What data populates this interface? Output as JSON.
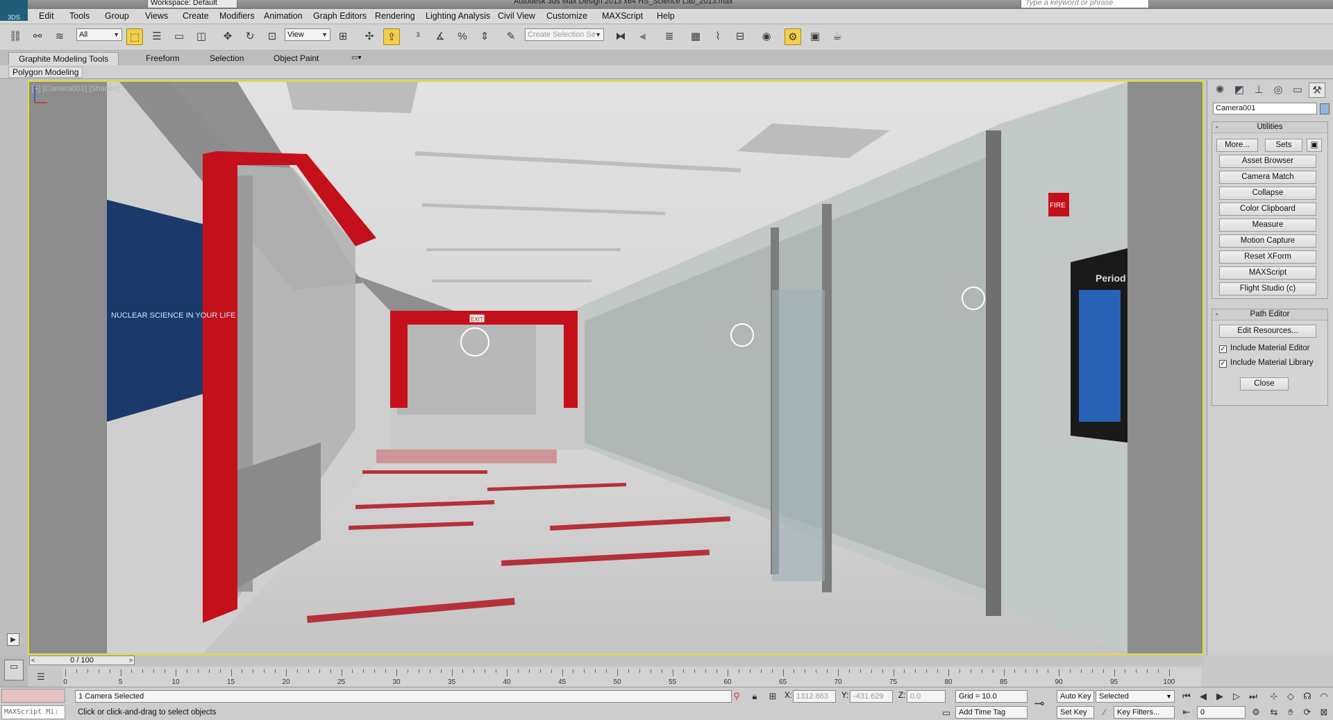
{
  "title": {
    "workspace": "Workspace: Default",
    "window_title": "Autodesk 3ds Max Design 2013 x64    HS_Science Lab_2013.max",
    "search_placeholder": "Type a keyword or phrase"
  },
  "menu": [
    "Edit",
    "Tools",
    "Group",
    "Views",
    "Create",
    "Modifiers",
    "Animation",
    "Graph Editors",
    "Rendering",
    "Lighting Analysis",
    "Civil View",
    "Customize",
    "MAXScript",
    "Help"
  ],
  "toolbar": {
    "selection_filter": "All",
    "reference_coord": "View",
    "named_selection_placeholder": "Create Selection Se"
  },
  "ribbon": {
    "tabs": [
      "Graphite Modeling Tools",
      "Freeform",
      "Selection",
      "Object Paint"
    ],
    "active_tab": "Graphite Modeling Tools",
    "panel_label": "Polygon Modeling"
  },
  "viewport": {
    "label": "[+] [Camera001] [Shaded]",
    "poster_text": "NUCLEAR SCIENCE IN YOUR LIFE",
    "periodic_text": "Period",
    "fire_sign": "FIRE",
    "exit_sign": "EXIT"
  },
  "command_panel": {
    "object_name": "Camera001",
    "utilities": {
      "title": "Utilities",
      "more_label": "More...",
      "sets_label": "Sets",
      "buttons": [
        "Asset Browser",
        "Camera Match",
        "Collapse",
        "Color Clipboard",
        "Measure",
        "Motion Capture",
        "Reset XForm",
        "MAXScript",
        "Flight Studio (c)"
      ]
    },
    "path_editor": {
      "title": "Path Editor",
      "edit_resources_label": "Edit Resources...",
      "include_material_editor": "Include Material Editor",
      "include_material_library": "Include Material Library",
      "close_label": "Close"
    }
  },
  "timeline": {
    "frame_display": "0 / 100",
    "ticks": [
      "0",
      "5",
      "10",
      "15",
      "20",
      "25",
      "30",
      "35",
      "40",
      "45",
      "50",
      "55",
      "60",
      "65",
      "70",
      "75",
      "80",
      "85",
      "90",
      "95",
      "100"
    ]
  },
  "status": {
    "selection": "1 Camera Selected",
    "prompt": "Click or click-and-drag to select objects",
    "x_label": "X:",
    "x_value": "1312.863",
    "y_label": "Y:",
    "y_value": "-431.629",
    "z_label": "Z:",
    "z_value": "0.0",
    "grid": "Grid = 10.0",
    "add_time_tag": "Add Time Tag",
    "auto_key": "Auto Key",
    "set_key": "Set Key",
    "key_mode": "Selected",
    "key_filters": "Key Filters...",
    "current_frame": "0",
    "maxscript_mini": "MAXScript Mi:"
  },
  "colors": {
    "viewport_border": "#e8da2c",
    "accent_red": "#c4101a",
    "active_button": "#f2cf4b"
  }
}
